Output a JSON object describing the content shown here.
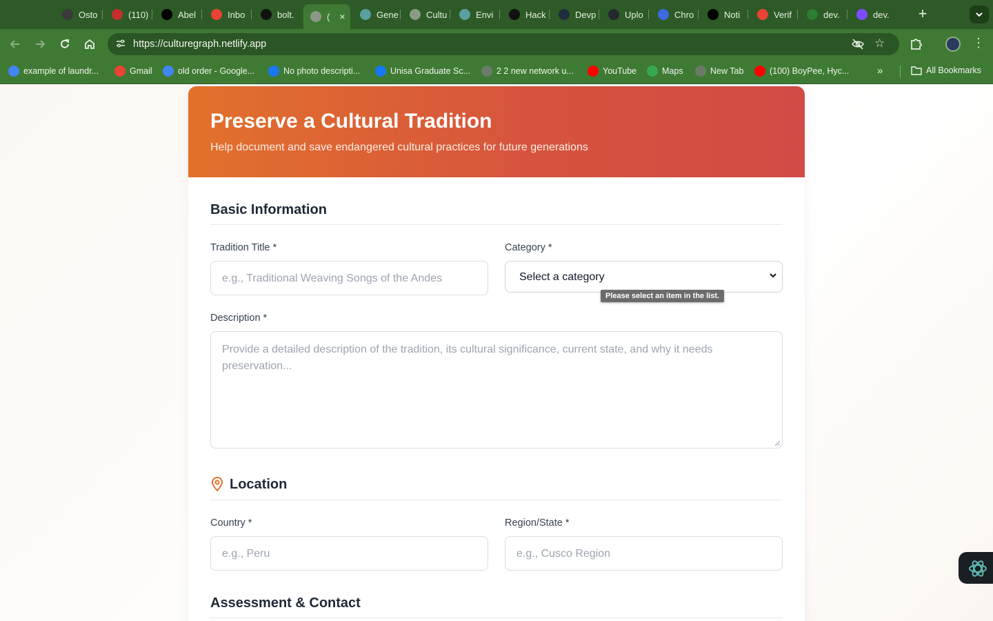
{
  "browser": {
    "tabs": [
      {
        "label": "Osto",
        "icon": "openai-icon",
        "color": "#3a3a3a"
      },
      {
        "label": "(110)",
        "icon": "counter-icon",
        "color": "#c4302b"
      },
      {
        "label": "Abel",
        "icon": "x-icon",
        "color": "#000000"
      },
      {
        "label": "Inbo",
        "icon": "gmail-icon",
        "color": "#ea4335"
      },
      {
        "label": "bolt.",
        "icon": "bolt-icon",
        "color": "#111111"
      },
      {
        "label": "(",
        "icon": "globe-icon",
        "color": "#8a9a86",
        "active": true
      },
      {
        "label": "Gene",
        "icon": "diamond-icon",
        "color": "#5aa0a0"
      },
      {
        "label": "Cultu",
        "icon": "globe-icon",
        "color": "#8a9a86"
      },
      {
        "label": "Envi",
        "icon": "diamond-icon",
        "color": "#5aa0a0"
      },
      {
        "label": "Hack",
        "icon": "bolt-icon",
        "color": "#111111"
      },
      {
        "label": "Devp",
        "icon": "devpost-icon",
        "color": "#1f2d3d"
      },
      {
        "label": "Uplo",
        "icon": "github-icon",
        "color": "#24292e"
      },
      {
        "label": "Chro",
        "icon": "chrome-icon",
        "color": "#3d6ae0"
      },
      {
        "label": "Noti",
        "icon": "x-icon",
        "color": "#000000"
      },
      {
        "label": "Verif",
        "icon": "gmail-icon",
        "color": "#ea4335"
      },
      {
        "label": "dev.",
        "icon": "dev-icon",
        "color": "#2e7d32"
      },
      {
        "label": "dev.",
        "icon": "dev-icon",
        "color": "#7c4dff"
      }
    ],
    "url": "https://culturegraph.netlify.app",
    "bookmarks": [
      {
        "label": "example of laundr...",
        "icon": "google-icon",
        "color": "#4285f4"
      },
      {
        "label": "Gmail",
        "icon": "gmail-icon",
        "color": "#ea4335"
      },
      {
        "label": "old order - Google...",
        "icon": "google-icon",
        "color": "#4285f4"
      },
      {
        "label": "No photo descripti...",
        "icon": "facebook-icon",
        "color": "#1877f2"
      },
      {
        "label": "Unisa Graduate Sc...",
        "icon": "facebook-icon",
        "color": "#1877f2"
      },
      {
        "label": "2 2 new network u...",
        "icon": "globe-icon",
        "color": "#6b7b68"
      },
      {
        "label": "YouTube",
        "icon": "youtube-icon",
        "color": "#ff0000"
      },
      {
        "label": "Maps",
        "icon": "maps-icon",
        "color": "#34a853"
      },
      {
        "label": "New Tab",
        "icon": "globe-icon",
        "color": "#6b7b68"
      },
      {
        "label": "(100) BoyPee, Hyc...",
        "icon": "youtube-icon",
        "color": "#ff0000"
      }
    ],
    "all_bookmarks": "All Bookmarks"
  },
  "hero": {
    "title": "Preserve a Cultural Tradition",
    "subtitle": "Help document and save endangered cultural practices for future generations"
  },
  "basic": {
    "heading": "Basic Information",
    "title_label": "Tradition Title *",
    "title_placeholder": "e.g., Traditional Weaving Songs of the Andes",
    "category_label": "Category *",
    "category_value": "Select a category",
    "category_tooltip": "Please select an item in the list.",
    "description_label": "Description *",
    "description_placeholder": "Provide a detailed description of the tradition, its cultural significance, current state, and why it needs preservation..."
  },
  "location": {
    "heading": "Location",
    "country_label": "Country *",
    "country_placeholder": "e.g., Peru",
    "region_label": "Region/State *",
    "region_placeholder": "e.g., Cusco Region"
  },
  "assessment": {
    "heading": "Assessment & Contact"
  },
  "colors": {
    "accent_start": "#e2712c",
    "accent_end": "#d24a45",
    "chrome_green": "#3f7a34"
  }
}
